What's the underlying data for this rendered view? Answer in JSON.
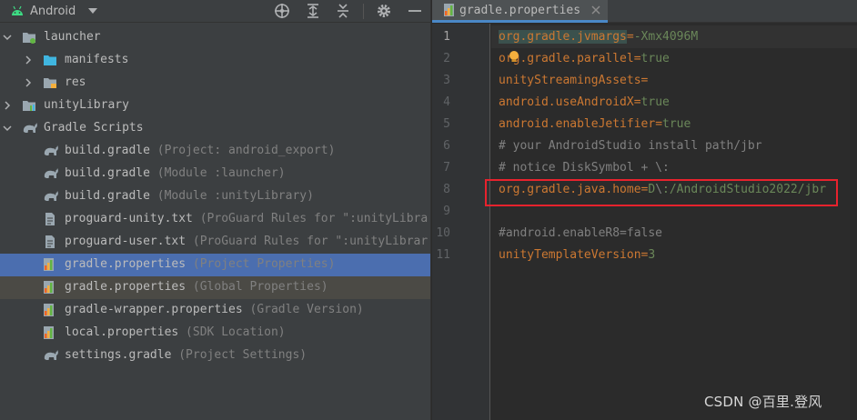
{
  "project_panel": {
    "view_label": "Android",
    "toolbar_icons": [
      "crosshair-icon",
      "expand-all-icon",
      "collapse-all-icon",
      "gear-icon",
      "minimize-icon"
    ],
    "tree": [
      {
        "name": "launcher",
        "hint": "",
        "icon": "module-folder-icon",
        "arrow": "down",
        "indent": 0,
        "state": ""
      },
      {
        "name": "manifests",
        "hint": "",
        "icon": "folder-icon",
        "arrow": "right",
        "indent": 1,
        "state": ""
      },
      {
        "name": "res",
        "hint": "",
        "icon": "res-folder-icon",
        "arrow": "right",
        "indent": 1,
        "state": ""
      },
      {
        "name": "unityLibrary",
        "hint": "",
        "icon": "library-module-icon",
        "arrow": "right",
        "indent": 0,
        "state": ""
      },
      {
        "name": "Gradle Scripts",
        "hint": "",
        "icon": "gradle-elephant-icon",
        "arrow": "down",
        "indent": 0,
        "state": ""
      },
      {
        "name": "build.gradle",
        "hint": " (Project: android_export)",
        "icon": "gradle-elephant-icon",
        "arrow": "",
        "indent": 1,
        "state": ""
      },
      {
        "name": "build.gradle",
        "hint": " (Module :launcher)",
        "icon": "gradle-elephant-icon",
        "arrow": "",
        "indent": 1,
        "state": ""
      },
      {
        "name": "build.gradle",
        "hint": " (Module :unityLibrary)",
        "icon": "gradle-elephant-icon",
        "arrow": "",
        "indent": 1,
        "state": ""
      },
      {
        "name": "proguard-unity.txt",
        "hint": " (ProGuard Rules for \":unityLibra",
        "icon": "text-file-icon",
        "arrow": "",
        "indent": 1,
        "state": ""
      },
      {
        "name": "proguard-user.txt",
        "hint": " (ProGuard Rules for \":unityLibrar",
        "icon": "text-file-icon",
        "arrow": "",
        "indent": 1,
        "state": ""
      },
      {
        "name": "gradle.properties",
        "hint": " (Project Properties)",
        "icon": "properties-file-icon",
        "arrow": "",
        "indent": 1,
        "state": "selected"
      },
      {
        "name": "gradle.properties",
        "hint": " (Global Properties)",
        "icon": "properties-file-icon",
        "arrow": "",
        "indent": 1,
        "state": "inactive"
      },
      {
        "name": "gradle-wrapper.properties",
        "hint": " (Gradle Version)",
        "icon": "properties-file-icon",
        "arrow": "",
        "indent": 1,
        "state": ""
      },
      {
        "name": "local.properties",
        "hint": " (SDK Location)",
        "icon": "properties-file-icon",
        "arrow": "",
        "indent": 1,
        "state": ""
      },
      {
        "name": "settings.gradle",
        "hint": " (Project Settings)",
        "icon": "gradle-elephant-icon",
        "arrow": "",
        "indent": 1,
        "state": ""
      }
    ]
  },
  "editor": {
    "tab_label": "gradle.properties",
    "current_line": 1,
    "lines": [
      {
        "n": "1",
        "segs": [
          [
            "k hl",
            "org.gradle.jvmargs"
          ],
          [
            "eq",
            "="
          ],
          [
            "v",
            "-Xmx4096M"
          ]
        ]
      },
      {
        "n": "2",
        "segs": [
          [
            "k",
            "org.gradle.parallel"
          ],
          [
            "eq",
            "="
          ],
          [
            "v",
            "true"
          ]
        ]
      },
      {
        "n": "3",
        "segs": [
          [
            "k",
            "unityStreamingAssets"
          ],
          [
            "eq",
            "="
          ]
        ]
      },
      {
        "n": "4",
        "segs": [
          [
            "k",
            "android.useAndroidX"
          ],
          [
            "eq",
            "="
          ],
          [
            "v",
            "true"
          ]
        ]
      },
      {
        "n": "5",
        "segs": [
          [
            "k",
            "android.enableJetifier"
          ],
          [
            "eq",
            "="
          ],
          [
            "v",
            "true"
          ]
        ]
      },
      {
        "n": "6",
        "segs": [
          [
            "c",
            "# your AndroidStudio install path/jbr"
          ]
        ]
      },
      {
        "n": "7",
        "segs": [
          [
            "c",
            "# notice DiskSymbol + \\:"
          ]
        ]
      },
      {
        "n": "8",
        "segs": [
          [
            "k",
            "org.gradle.java.home"
          ],
          [
            "eq",
            "="
          ],
          [
            "v",
            "D"
          ],
          [
            "c",
            "\\"
          ],
          [
            "v",
            ":/AndroidStudio2022/jbr"
          ]
        ]
      },
      {
        "n": "9",
        "segs": []
      },
      {
        "n": "10",
        "segs": [
          [
            "c",
            "#android.enableR8=false"
          ]
        ]
      },
      {
        "n": "11",
        "segs": [
          [
            "k",
            "unityTemplateVersion"
          ],
          [
            "eq",
            "="
          ],
          [
            "v",
            "3"
          ]
        ]
      }
    ]
  },
  "watermark": "CSDN @百里.登风",
  "colors": {
    "accent": "#4b6eaf",
    "highlight_box": "#e8222d",
    "keyword": "#cc7832",
    "value": "#6a8759"
  }
}
